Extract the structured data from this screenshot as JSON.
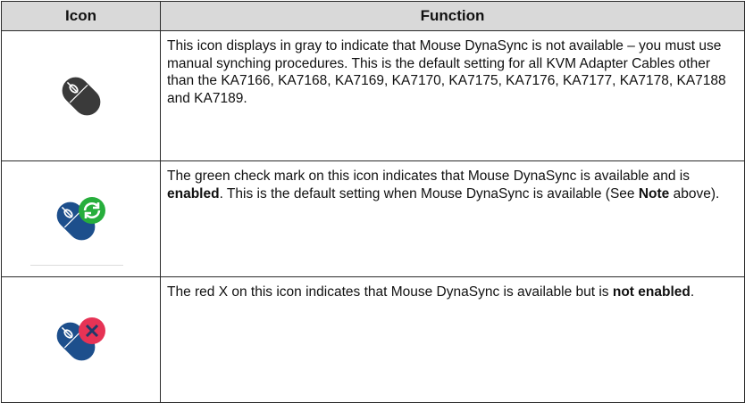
{
  "table": {
    "headers": {
      "icon": "Icon",
      "function": "Function"
    },
    "rows": [
      {
        "icon_name": "mouse-gray-icon",
        "parts": [
          {
            "text": "This icon displays in gray to indicate that Mouse DynaSync is not available – you must use manual synching procedures. This is the default setting for all KVM Adapter Cables other than the KA7166, KA7168, KA7169, KA7170, KA7175, KA7176, KA7177, KA7178, KA7188 and KA7189."
          }
        ]
      },
      {
        "icon_name": "mouse-dynasync-enabled-icon",
        "parts": [
          {
            "text": "The green check mark on this icon indicates that Mouse DynaSync is available and is "
          },
          {
            "text": "enabled",
            "bold": true
          },
          {
            "text": ". This is the default setting when Mouse DynaSync is available (See "
          },
          {
            "text": "Note",
            "bold": true
          },
          {
            "text": " above)."
          }
        ]
      },
      {
        "icon_name": "mouse-dynasync-disabled-icon",
        "parts": [
          {
            "text": "The red X on this icon indicates that Mouse DynaSync is available but is "
          },
          {
            "text": "not enabled",
            "bold": true
          },
          {
            "text": "."
          }
        ]
      }
    ]
  },
  "colors": {
    "header_bg": "#d9d9d9",
    "mouse_gray": "#3a3a3a",
    "mouse_blue": "#1d4f8c",
    "badge_green": "#27ae3c",
    "badge_red": "#e63355"
  }
}
